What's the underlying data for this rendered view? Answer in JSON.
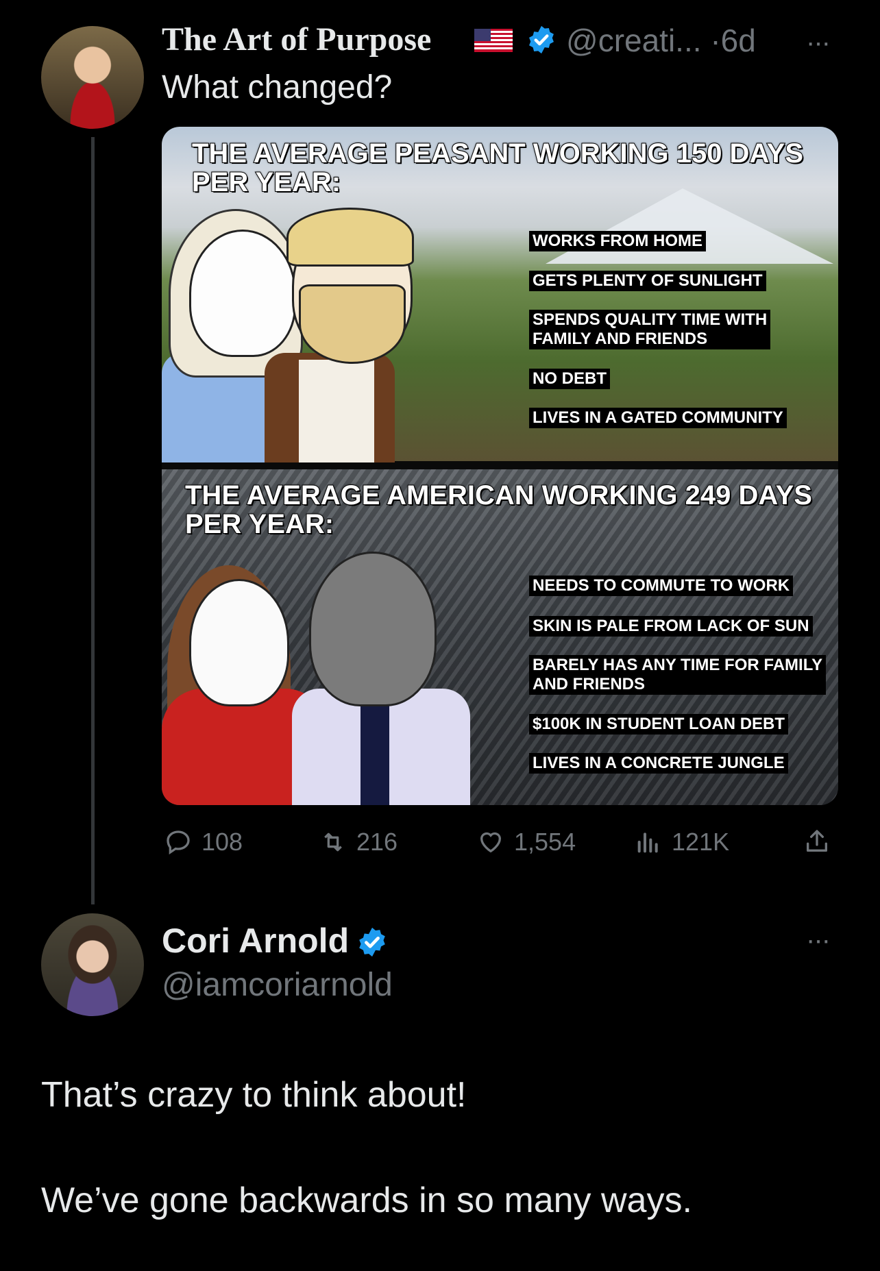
{
  "tweet": {
    "author_name": "The Art of Purpose",
    "handle": "@creati...",
    "separator": "·",
    "time": "6d",
    "text": "What changed?",
    "more": "···",
    "meme": {
      "top_heading": "THE AVERAGE PEASANT WORKING 150 DAYS\nPER YEAR:",
      "top_items": [
        "WORKS FROM HOME",
        "GETS PLENTY OF SUNLIGHT",
        "SPENDS QUALITY TIME WITH\nFAMILY AND FRIENDS",
        "NO DEBT",
        "LIVES IN A GATED COMMUNITY"
      ],
      "bottom_heading": "THE AVERAGE AMERICAN WORKING 249 DAYS\nPER YEAR:",
      "bottom_items": [
        "NEEDS TO COMMUTE TO WORK",
        "SKIN IS PALE FROM LACK OF SUN",
        "BARELY HAS ANY TIME FOR FAMILY\nAND FRIENDS",
        "$100K IN STUDENT LOAN DEBT",
        "LIVES IN A CONCRETE JUNGLE"
      ]
    },
    "actions": {
      "replies": "108",
      "retweets": "216",
      "likes": "1,554",
      "views": "121K"
    }
  },
  "reply": {
    "author_name": "Cori Arnold",
    "handle": "@iamcoriarnold",
    "more": "···",
    "lines": [
      "That’s crazy to think about!",
      "We’ve gone backwards in so many ways."
    ]
  },
  "colors": {
    "background": "#000000",
    "text": "#e7e9ea",
    "muted": "#71767b",
    "verified": "#1d9bf0"
  },
  "icons": [
    "us-flag-icon",
    "verified-badge-icon",
    "reply-icon",
    "retweet-icon",
    "like-icon",
    "views-icon",
    "share-icon",
    "more-icon"
  ]
}
